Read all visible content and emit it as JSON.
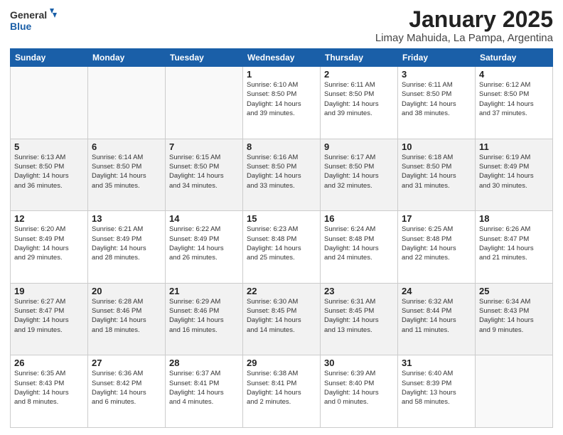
{
  "header": {
    "logo_general": "General",
    "logo_blue": "Blue",
    "main_title": "January 2025",
    "subtitle": "Limay Mahuida, La Pampa, Argentina"
  },
  "weekdays": [
    "Sunday",
    "Monday",
    "Tuesday",
    "Wednesday",
    "Thursday",
    "Friday",
    "Saturday"
  ],
  "weeks": [
    [
      {
        "day": "",
        "info": ""
      },
      {
        "day": "",
        "info": ""
      },
      {
        "day": "",
        "info": ""
      },
      {
        "day": "1",
        "info": "Sunrise: 6:10 AM\nSunset: 8:50 PM\nDaylight: 14 hours\nand 39 minutes."
      },
      {
        "day": "2",
        "info": "Sunrise: 6:11 AM\nSunset: 8:50 PM\nDaylight: 14 hours\nand 39 minutes."
      },
      {
        "day": "3",
        "info": "Sunrise: 6:11 AM\nSunset: 8:50 PM\nDaylight: 14 hours\nand 38 minutes."
      },
      {
        "day": "4",
        "info": "Sunrise: 6:12 AM\nSunset: 8:50 PM\nDaylight: 14 hours\nand 37 minutes."
      }
    ],
    [
      {
        "day": "5",
        "info": "Sunrise: 6:13 AM\nSunset: 8:50 PM\nDaylight: 14 hours\nand 36 minutes."
      },
      {
        "day": "6",
        "info": "Sunrise: 6:14 AM\nSunset: 8:50 PM\nDaylight: 14 hours\nand 35 minutes."
      },
      {
        "day": "7",
        "info": "Sunrise: 6:15 AM\nSunset: 8:50 PM\nDaylight: 14 hours\nand 34 minutes."
      },
      {
        "day": "8",
        "info": "Sunrise: 6:16 AM\nSunset: 8:50 PM\nDaylight: 14 hours\nand 33 minutes."
      },
      {
        "day": "9",
        "info": "Sunrise: 6:17 AM\nSunset: 8:50 PM\nDaylight: 14 hours\nand 32 minutes."
      },
      {
        "day": "10",
        "info": "Sunrise: 6:18 AM\nSunset: 8:50 PM\nDaylight: 14 hours\nand 31 minutes."
      },
      {
        "day": "11",
        "info": "Sunrise: 6:19 AM\nSunset: 8:49 PM\nDaylight: 14 hours\nand 30 minutes."
      }
    ],
    [
      {
        "day": "12",
        "info": "Sunrise: 6:20 AM\nSunset: 8:49 PM\nDaylight: 14 hours\nand 29 minutes."
      },
      {
        "day": "13",
        "info": "Sunrise: 6:21 AM\nSunset: 8:49 PM\nDaylight: 14 hours\nand 28 minutes."
      },
      {
        "day": "14",
        "info": "Sunrise: 6:22 AM\nSunset: 8:49 PM\nDaylight: 14 hours\nand 26 minutes."
      },
      {
        "day": "15",
        "info": "Sunrise: 6:23 AM\nSunset: 8:48 PM\nDaylight: 14 hours\nand 25 minutes."
      },
      {
        "day": "16",
        "info": "Sunrise: 6:24 AM\nSunset: 8:48 PM\nDaylight: 14 hours\nand 24 minutes."
      },
      {
        "day": "17",
        "info": "Sunrise: 6:25 AM\nSunset: 8:48 PM\nDaylight: 14 hours\nand 22 minutes."
      },
      {
        "day": "18",
        "info": "Sunrise: 6:26 AM\nSunset: 8:47 PM\nDaylight: 14 hours\nand 21 minutes."
      }
    ],
    [
      {
        "day": "19",
        "info": "Sunrise: 6:27 AM\nSunset: 8:47 PM\nDaylight: 14 hours\nand 19 minutes."
      },
      {
        "day": "20",
        "info": "Sunrise: 6:28 AM\nSunset: 8:46 PM\nDaylight: 14 hours\nand 18 minutes."
      },
      {
        "day": "21",
        "info": "Sunrise: 6:29 AM\nSunset: 8:46 PM\nDaylight: 14 hours\nand 16 minutes."
      },
      {
        "day": "22",
        "info": "Sunrise: 6:30 AM\nSunset: 8:45 PM\nDaylight: 14 hours\nand 14 minutes."
      },
      {
        "day": "23",
        "info": "Sunrise: 6:31 AM\nSunset: 8:45 PM\nDaylight: 14 hours\nand 13 minutes."
      },
      {
        "day": "24",
        "info": "Sunrise: 6:32 AM\nSunset: 8:44 PM\nDaylight: 14 hours\nand 11 minutes."
      },
      {
        "day": "25",
        "info": "Sunrise: 6:34 AM\nSunset: 8:43 PM\nDaylight: 14 hours\nand 9 minutes."
      }
    ],
    [
      {
        "day": "26",
        "info": "Sunrise: 6:35 AM\nSunset: 8:43 PM\nDaylight: 14 hours\nand 8 minutes."
      },
      {
        "day": "27",
        "info": "Sunrise: 6:36 AM\nSunset: 8:42 PM\nDaylight: 14 hours\nand 6 minutes."
      },
      {
        "day": "28",
        "info": "Sunrise: 6:37 AM\nSunset: 8:41 PM\nDaylight: 14 hours\nand 4 minutes."
      },
      {
        "day": "29",
        "info": "Sunrise: 6:38 AM\nSunset: 8:41 PM\nDaylight: 14 hours\nand 2 minutes."
      },
      {
        "day": "30",
        "info": "Sunrise: 6:39 AM\nSunset: 8:40 PM\nDaylight: 14 hours\nand 0 minutes."
      },
      {
        "day": "31",
        "info": "Sunrise: 6:40 AM\nSunset: 8:39 PM\nDaylight: 13 hours\nand 58 minutes."
      },
      {
        "day": "",
        "info": ""
      }
    ]
  ]
}
